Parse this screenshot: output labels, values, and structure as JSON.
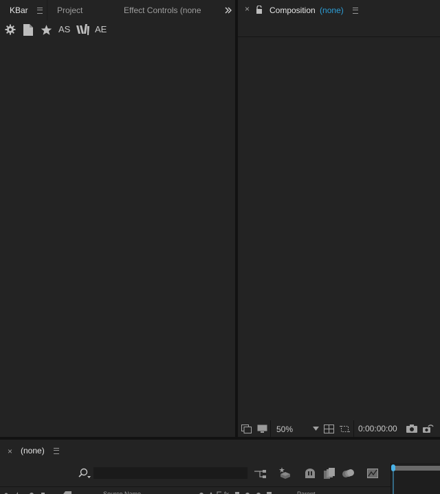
{
  "left_panel": {
    "tabs": [
      {
        "label": "KBar",
        "active": true
      },
      {
        "label": "Project",
        "active": false
      },
      {
        "label": "Effect Controls (none",
        "active": false
      }
    ],
    "overflow_icon": "double-chevron-right-icon",
    "kbar_buttons": [
      {
        "icon": "gear-icon"
      },
      {
        "icon": "document-icon"
      },
      {
        "icon": "star-icon"
      },
      {
        "label": "AS"
      },
      {
        "icon": "ae-w-logo-icon"
      },
      {
        "label": "AE"
      }
    ]
  },
  "composition_panel": {
    "close_glyph": "×",
    "lock_icon": "unlock-icon",
    "title": "Composition",
    "subtitle": "(none)",
    "subtitle_color": "#2d9fd8",
    "footer": {
      "zoom": "50%",
      "timecode": "0:00:00:00"
    }
  },
  "timeline_panel": {
    "close_glyph": "×",
    "title": "(none)",
    "search_placeholder": "",
    "columns": {
      "source_name": "Source Name",
      "parent": "Parent"
    },
    "playhead_color": "#4ab3e8"
  },
  "colors": {
    "background": "#1b1b1b",
    "panel": "#232323",
    "accent_blue": "#2d9fd8",
    "text": "#bdbdbd"
  }
}
